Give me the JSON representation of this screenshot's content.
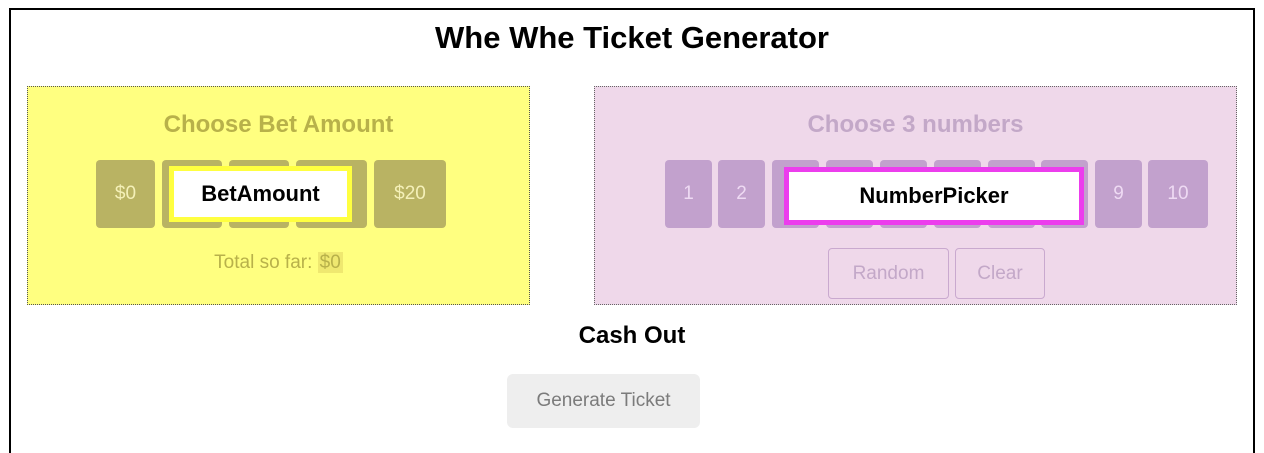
{
  "title": "Whe Whe Ticket Generator",
  "bet": {
    "heading": "Choose Bet Amount",
    "buttons": [
      "$0",
      "",
      "",
      "",
      "$20"
    ],
    "overlay_label": "BetAmount",
    "total_label": "Total so far:",
    "total_value": "$0"
  },
  "numbers": {
    "heading": "Choose 3 numbers",
    "buttons": [
      "1",
      "2",
      "",
      "",
      "",
      "",
      "",
      "",
      "9",
      "10"
    ],
    "overlay_label": "NumberPicker",
    "random_label": "Random",
    "clear_label": "Clear"
  },
  "cash_out": "Cash Out",
  "generate_label": "Generate Ticket",
  "colors": {
    "bet_panel": "#ffff80",
    "number_panel": "#efd8ea",
    "bet_highlight": "#ffff40",
    "number_highlight": "#ec3ded"
  }
}
